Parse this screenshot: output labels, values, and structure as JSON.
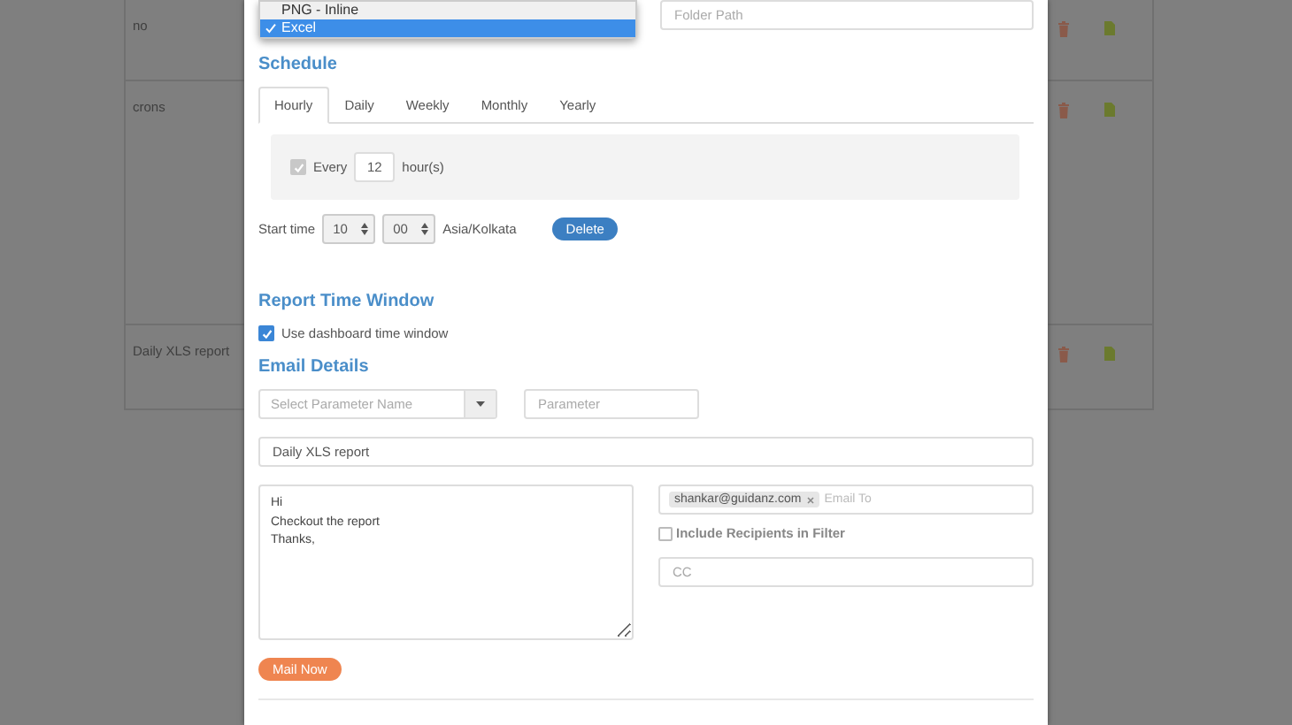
{
  "background_table": {
    "rows": [
      {
        "name": "no"
      },
      {
        "name": "crons"
      },
      {
        "name": "Daily XLS report"
      }
    ]
  },
  "format_dropdown": {
    "options": [
      {
        "label": "PNG - Inline",
        "selected": false
      },
      {
        "label": "Excel",
        "selected": true
      }
    ]
  },
  "folder_path": {
    "placeholder": "Folder Path"
  },
  "schedule": {
    "title": "Schedule",
    "tabs": [
      {
        "label": "Hourly",
        "selected": true
      },
      {
        "label": "Daily",
        "selected": false
      },
      {
        "label": "Weekly",
        "selected": false
      },
      {
        "label": "Monthly",
        "selected": false
      },
      {
        "label": "Yearly",
        "selected": false
      }
    ],
    "every": {
      "checked": true,
      "disabled": true,
      "label": "Every",
      "value": "12",
      "unit": "hour(s)"
    },
    "start_time": {
      "label": "Start time",
      "hour": "10",
      "minute": "00",
      "timezone": "Asia/Kolkata"
    },
    "delete_button": "Delete"
  },
  "report_time_window": {
    "title": "Report Time Window",
    "use_dashboard": {
      "label": "Use dashboard time window",
      "checked": true
    }
  },
  "email_details": {
    "title": "Email Details",
    "parameter_name": {
      "placeholder": "Select Parameter Name"
    },
    "parameter": {
      "placeholder": "Parameter"
    },
    "subject": {
      "value": "Daily XLS report"
    },
    "body": {
      "value": "Hi\nCheckout the report\nThanks,"
    },
    "email_to": {
      "recipients": [
        {
          "label": "shankar@guidanz.com"
        }
      ],
      "placeholder": "Email To"
    },
    "include_recipients": {
      "label": "Include Recipients in Filter",
      "checked": false
    },
    "cc": {
      "placeholder": "CC"
    },
    "mail_button": "Mail Now"
  }
}
